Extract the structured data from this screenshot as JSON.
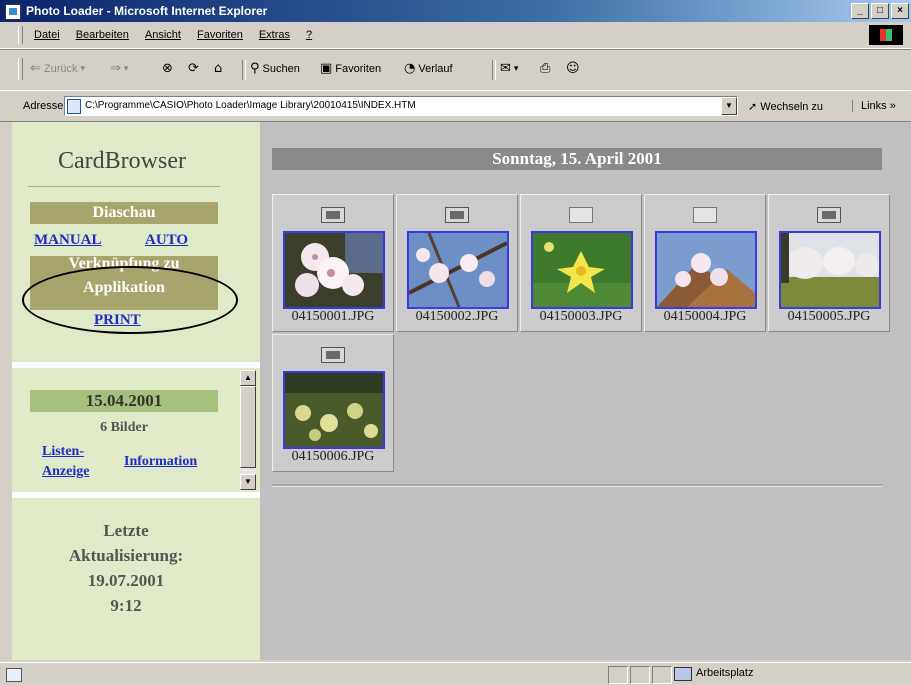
{
  "window": {
    "title": "Photo Loader - Microsoft Internet Explorer",
    "controls": [
      "_",
      "□",
      "×"
    ]
  },
  "menu": [
    "Datei",
    "Bearbeiten",
    "Ansicht",
    "Favoriten",
    "Extras",
    "?"
  ],
  "toolbar": {
    "back": "Zurück",
    "search": "Suchen",
    "favorites": "Favoriten",
    "history": "Verlauf"
  },
  "address": {
    "label": "Adresse",
    "url": "C:\\Programme\\CASIO\\Photo Loader\\Image Library\\20010415\\INDEX.HTM",
    "go": "Wechseln zu",
    "links": "Links »"
  },
  "left": {
    "title": "CardBrowser",
    "slideshow_header": "Diaschau",
    "manual": "MANUAL",
    "auto": "AUTO",
    "app_link_header_1": "Verknüpfung zu",
    "app_link_header_2": "Applikation",
    "print": "PRINT",
    "date": "15.04.2001",
    "count": "6 Bilder",
    "list_view_1": "Listen-",
    "list_view_2": "Anzeige",
    "information": "Information",
    "update_1": "Letzte",
    "update_2": "Aktualisierung:",
    "update_3": "19.07.2001",
    "update_4": "9:12"
  },
  "main": {
    "day_header": "Sonntag, 15. April 2001",
    "photos": [
      {
        "file": "04150001.JPG",
        "checked": true
      },
      {
        "file": "04150002.JPG",
        "checked": true
      },
      {
        "file": "04150003.JPG",
        "checked": false
      },
      {
        "file": "04150004.JPG",
        "checked": false
      },
      {
        "file": "04150005.JPG",
        "checked": true
      },
      {
        "file": "04150006.JPG",
        "checked": true
      }
    ]
  },
  "status": {
    "zone": "Arbeitsplatz"
  }
}
